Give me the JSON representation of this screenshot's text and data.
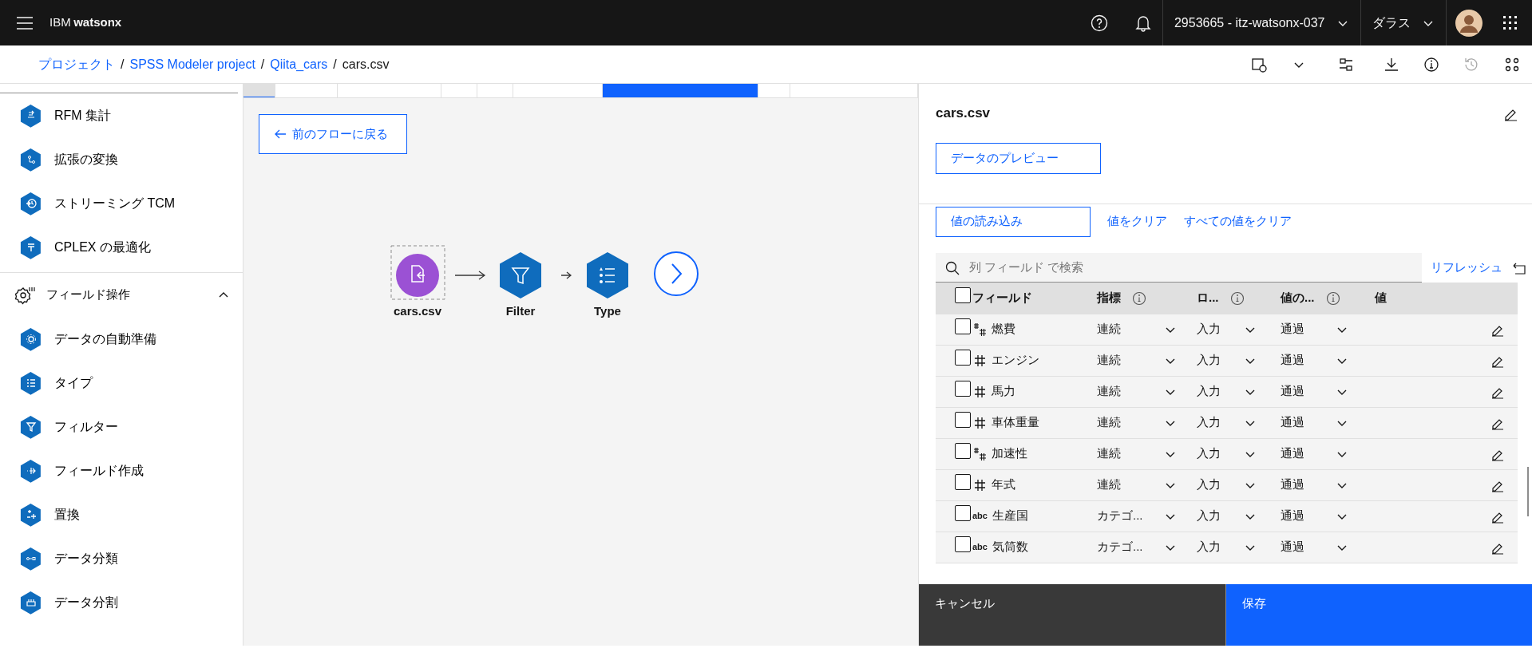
{
  "header": {
    "brand_prefix": "IBM",
    "brand": "watsonx",
    "account": "2953665 - itz-watsonx-037",
    "region": "ダラス"
  },
  "breadcrumbs": [
    {
      "label": "プロジェクト",
      "link": true,
      "separator": "/"
    },
    {
      "label": "SPSS Modeler project",
      "link": true,
      "separator": "/"
    },
    {
      "label": "Qiita_cars",
      "link": true,
      "separator": "/"
    },
    {
      "label": "cars.csv",
      "link": false
    }
  ],
  "palette": {
    "items": [
      {
        "label": "RFM 集計"
      },
      {
        "label": "拡張の変換"
      },
      {
        "label": "ストリーミング TCM"
      },
      {
        "label": "CPLEX の最適化"
      }
    ],
    "section": {
      "label": "フィールド操作",
      "expanded": true
    },
    "section_items": [
      {
        "label": "データの自動準備"
      },
      {
        "label": "タイプ"
      },
      {
        "label": "フィルター"
      },
      {
        "label": "フィールド作成"
      },
      {
        "label": "置換"
      },
      {
        "label": "データ分類"
      },
      {
        "label": "データ分割"
      }
    ]
  },
  "canvas": {
    "back_button": "前のフローに戻る",
    "nodes": [
      {
        "label": "cars.csv",
        "kind": "source",
        "selected": true
      },
      {
        "label": "Filter",
        "kind": "filter",
        "selected": false
      },
      {
        "label": "Type",
        "kind": "type",
        "selected": false
      }
    ]
  },
  "panel": {
    "title": "cars.csv",
    "preview_button": "データのプレビュー",
    "actions": [
      {
        "label": "値の読み込み",
        "kind": "outline"
      },
      {
        "label": "値をクリア",
        "kind": "link"
      },
      {
        "label": "すべての値をクリア",
        "kind": "link"
      }
    ],
    "search": {
      "placeholder": "列 フィールド で検索"
    },
    "refresh": "リフレッシュ",
    "table": {
      "select_all_checked": false,
      "columns": [
        {
          "label": "フィールド",
          "info": false
        },
        {
          "label": "指標",
          "info": true
        },
        {
          "label": "ロ...",
          "info": true
        },
        {
          "label": "値の...",
          "info": true
        },
        {
          "label": "値",
          "info": false
        }
      ],
      "rows": [
        {
          "checked": false,
          "kind": "real",
          "name": "燃費",
          "measure": "連続",
          "role": "入力",
          "handling": "通過"
        },
        {
          "checked": false,
          "kind": "integer",
          "name": "エンジン",
          "measure": "連続",
          "role": "入力",
          "handling": "通過"
        },
        {
          "checked": false,
          "kind": "integer",
          "name": "馬力",
          "measure": "連続",
          "role": "入力",
          "handling": "通過"
        },
        {
          "checked": false,
          "kind": "integer",
          "name": "車体重量",
          "measure": "連続",
          "role": "入力",
          "handling": "通過"
        },
        {
          "checked": false,
          "kind": "real",
          "name": "加速性",
          "measure": "連続",
          "role": "入力",
          "handling": "通過"
        },
        {
          "checked": false,
          "kind": "integer",
          "name": "年式",
          "measure": "連続",
          "role": "入力",
          "handling": "通過"
        },
        {
          "checked": false,
          "kind": "string",
          "type_label": "abc",
          "name": "生産国",
          "measure": "カテゴ...",
          "role": "入力",
          "handling": "通過"
        },
        {
          "checked": false,
          "kind": "string",
          "type_label": "abc",
          "name": "気筒数",
          "measure": "カテゴ...",
          "role": "入力",
          "handling": "通過"
        }
      ]
    }
  },
  "footer": {
    "cancel": "キャンセル",
    "save": "保存"
  }
}
